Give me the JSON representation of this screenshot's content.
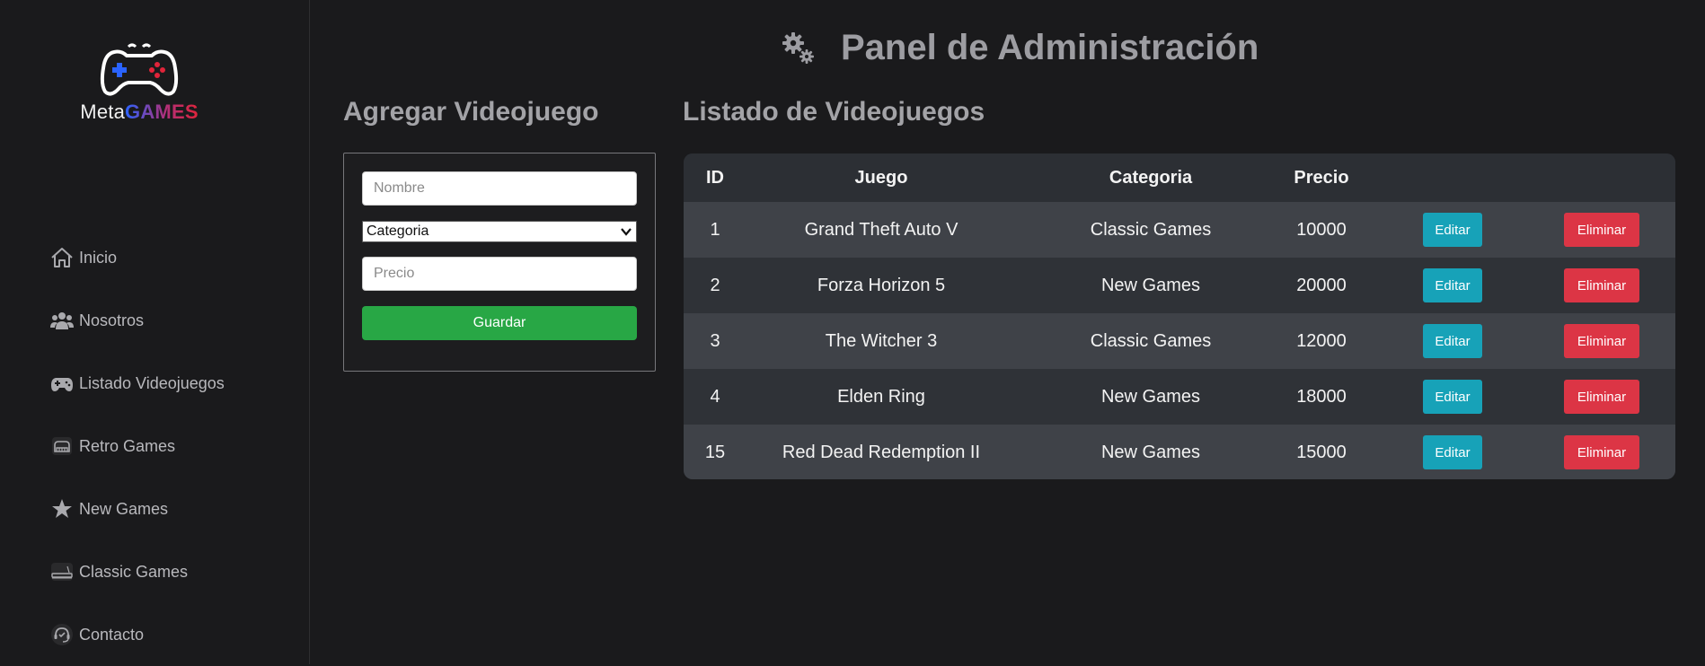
{
  "brand": {
    "meta": "Meta",
    "games": "GAMES"
  },
  "sidebar": {
    "items": [
      {
        "label": "Inicio",
        "icon": "home-icon"
      },
      {
        "label": "Nosotros",
        "icon": "users-icon"
      },
      {
        "label": "Listado Videojuegos",
        "icon": "gamepad-icon"
      },
      {
        "label": "Retro Games",
        "icon": "retro-console-icon"
      },
      {
        "label": "New Games",
        "icon": "star-icon"
      },
      {
        "label": "Classic Games",
        "icon": "console-icon"
      },
      {
        "label": "Contacto",
        "icon": "support-icon"
      }
    ]
  },
  "header": {
    "title": "Panel de Administración",
    "icon": "gears-icon"
  },
  "form": {
    "title": "Agregar Videojuego",
    "nombre_placeholder": "Nombre",
    "categoria_selected": "Categoria",
    "precio_placeholder": "Precio",
    "submit_label": "Guardar"
  },
  "list": {
    "title": "Listado de Videojuegos",
    "columns": [
      "ID",
      "Juego",
      "Categoria",
      "Precio"
    ],
    "edit_label": "Editar",
    "delete_label": "Eliminar",
    "rows": [
      {
        "id": "1",
        "juego": "Grand Theft Auto V",
        "categoria": "Classic Games",
        "precio": "10000"
      },
      {
        "id": "2",
        "juego": "Forza Horizon 5",
        "categoria": "New Games",
        "precio": "20000"
      },
      {
        "id": "3",
        "juego": "The Witcher 3",
        "categoria": "Classic Games",
        "precio": "12000"
      },
      {
        "id": "4",
        "juego": "Elden Ring",
        "categoria": "New Games",
        "precio": "18000"
      },
      {
        "id": "15",
        "juego": "Red Dead Redemption II",
        "categoria": "New Games",
        "precio": "15000"
      }
    ]
  },
  "colors": {
    "background": "#1a1a1c",
    "save": "#28a745",
    "edit": "#17a2b8",
    "delete": "#dc3545",
    "brand_blue": "#2a63ff",
    "brand_red": "#e0243a"
  }
}
